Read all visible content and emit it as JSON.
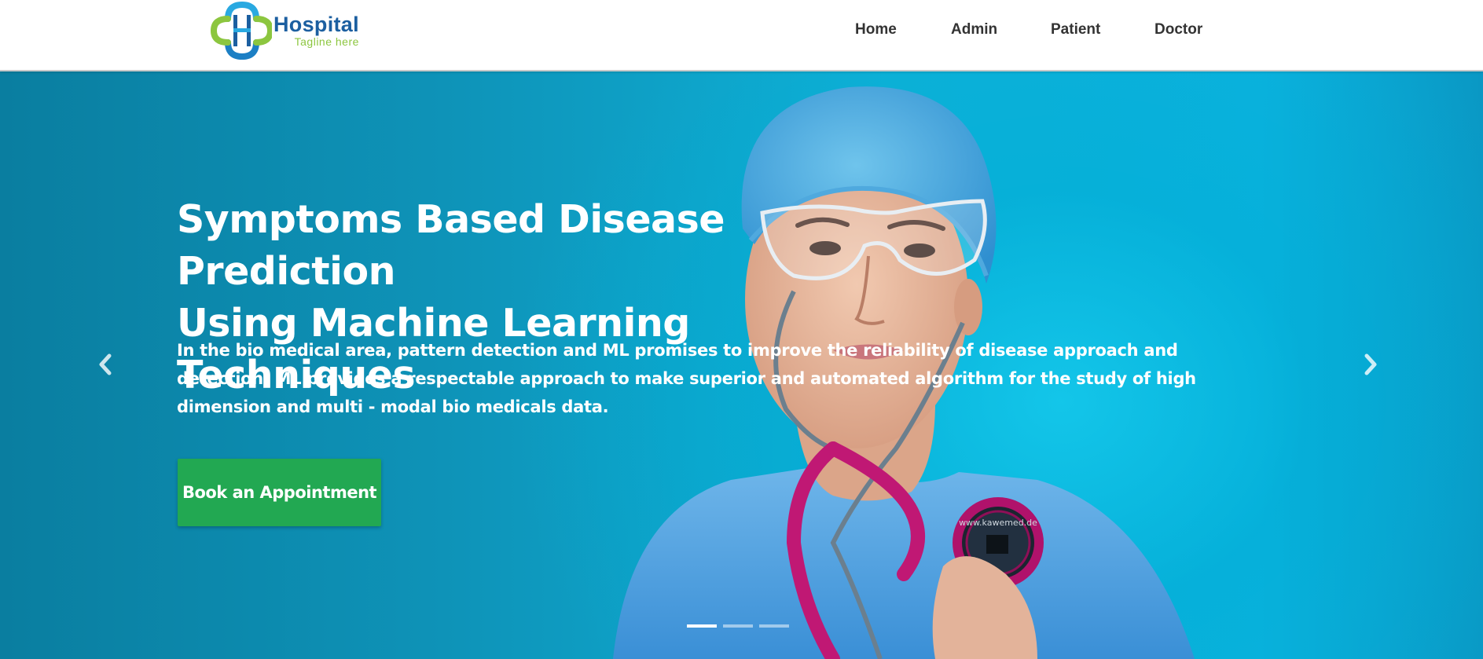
{
  "brand": {
    "name": "Hospital",
    "tagline": "Tagline here",
    "colors": {
      "blue": "#1c5fa0",
      "green": "#8cc63f",
      "light_blue": "#29a9e1"
    }
  },
  "nav": {
    "items": [
      {
        "label": "Home"
      },
      {
        "label": "Admin"
      },
      {
        "label": "Patient"
      },
      {
        "label": "Doctor"
      }
    ]
  },
  "hero": {
    "title_line1": "Symptoms Based Disease Prediction",
    "title_line2": "Using Machine Learning Techniques",
    "description": "In the bio medical area, pattern detection and ML promises to improve the reliability of disease approach and detection. ML provides a respectable approach to make superior and automated algorithm for the study of high dimension and multi - modal bio medicals data.",
    "cta_label": "Book an Appointment",
    "stethoscope_text": "www.kawemed.de",
    "prev_icon": "chevron-left-icon",
    "next_icon": "chevron-right-icon",
    "slides": {
      "count": 3,
      "active_index": 0
    },
    "colors": {
      "background": "#0fb0d6",
      "cta": "#22a852"
    }
  }
}
